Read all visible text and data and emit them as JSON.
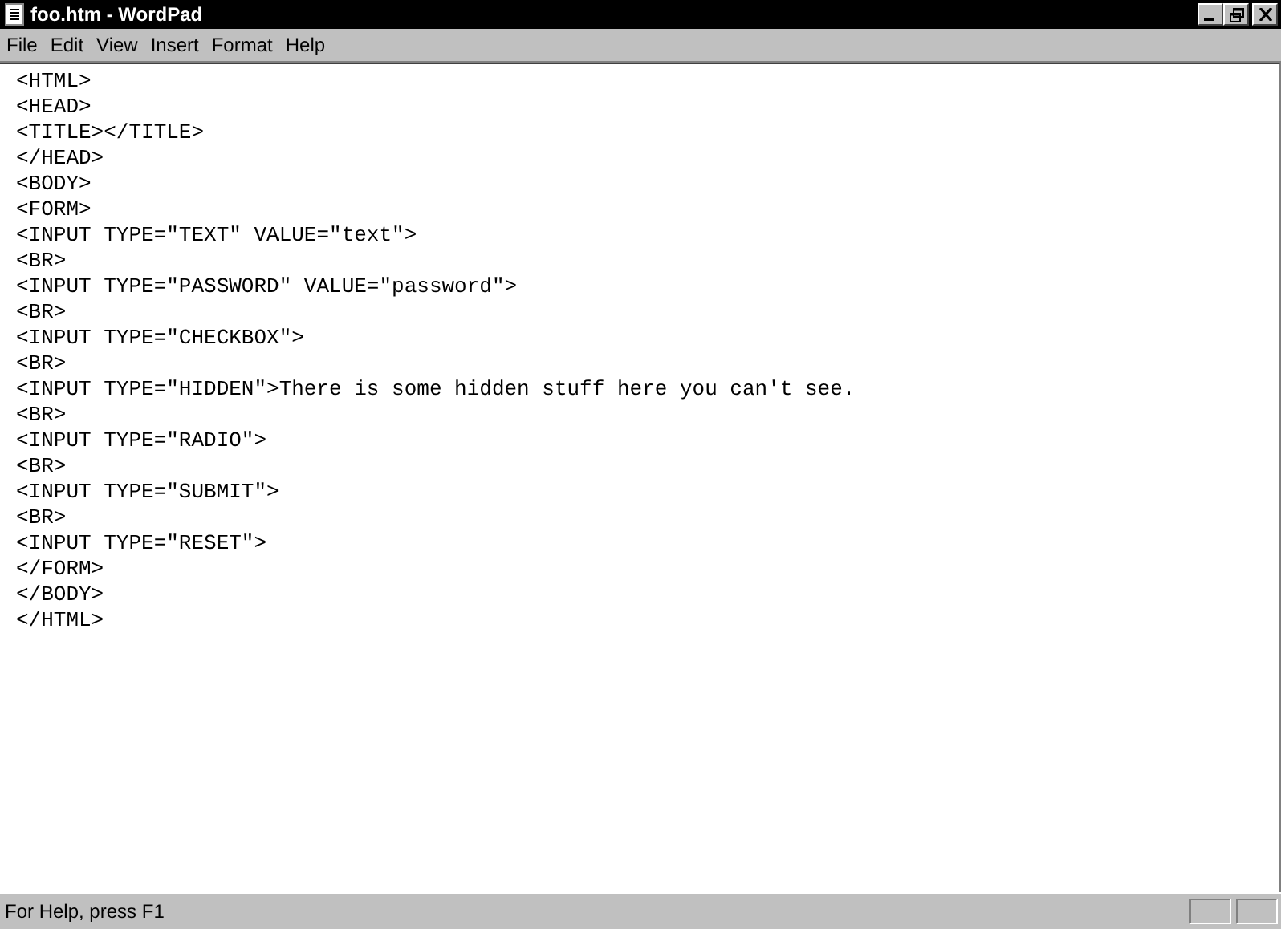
{
  "window": {
    "title": "foo.htm - WordPad"
  },
  "menu": [
    "File",
    "Edit",
    "View",
    "Insert",
    "Format",
    "Help"
  ],
  "document": {
    "lines": [
      "<HTML>",
      "<HEAD>",
      "<TITLE></TITLE>",
      "</HEAD>",
      "<BODY>",
      "<FORM>",
      "<INPUT TYPE=\"TEXT\" VALUE=\"text\">",
      "<BR>",
      "<INPUT TYPE=\"PASSWORD\" VALUE=\"password\">",
      "<BR>",
      "<INPUT TYPE=\"CHECKBOX\">",
      "<BR>",
      "<INPUT TYPE=\"HIDDEN\">There is some hidden stuff here you can't see.",
      "<BR>",
      "<INPUT TYPE=\"RADIO\">",
      "<BR>",
      "<INPUT TYPE=\"SUBMIT\">",
      "<BR>",
      "<INPUT TYPE=\"RESET\">",
      "</FORM>",
      "</BODY>",
      "</HTML>"
    ]
  },
  "status_bar": {
    "text": "For Help, press F1"
  }
}
